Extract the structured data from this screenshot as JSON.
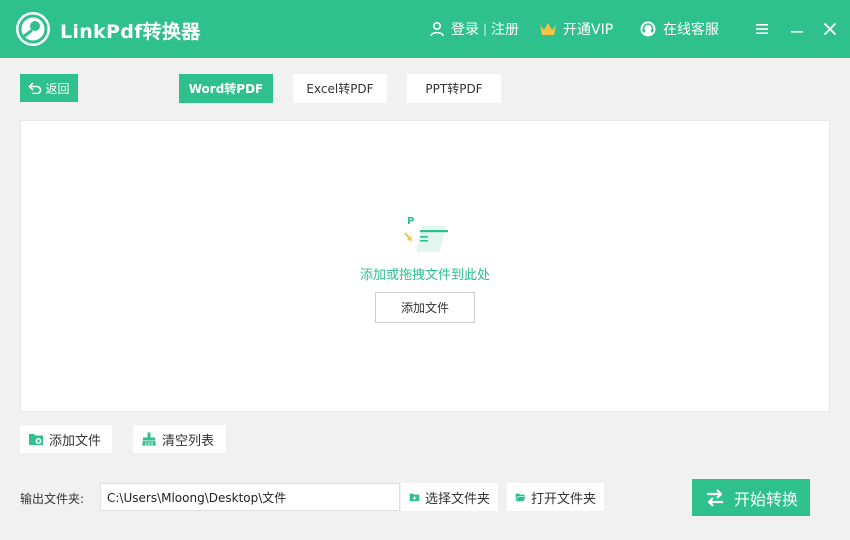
{
  "window": {
    "title": "LinkPdf转换器",
    "login_label": "登录",
    "separator": "|",
    "register_label": "注册",
    "vip_label": "开通VIP",
    "service_label": "在线客服"
  },
  "toolbar": {
    "back_label": "返回",
    "tabs": [
      {
        "label": "Word转PDF",
        "active": true
      },
      {
        "label": "Excel转PDF",
        "active": false
      },
      {
        "label": "PPT转PDF",
        "active": false
      }
    ]
  },
  "dropzone": {
    "hint": "添加或拖拽文件到此处",
    "add_button": "添加文件"
  },
  "actions": {
    "add_files": "添加文件",
    "clear_list": "清空列表"
  },
  "output": {
    "label": "输出文件夹:",
    "path": "C:\\Users\\Mloong\\Desktop\\文件",
    "choose_folder": "选择文件夹",
    "open_folder": "打开文件夹"
  },
  "start_label": "开始转换",
  "colors": {
    "accent": "#2ec08d",
    "background": "#f1f1f1",
    "vip_crown": "#f6c342"
  },
  "icons": [
    "app-logo-icon",
    "user-icon",
    "crown-icon",
    "headset-icon",
    "menu-icon",
    "minimize-icon",
    "close-icon",
    "back-arrow-icon",
    "file-drop-icon",
    "folder-add-icon",
    "broom-icon",
    "folder-open-icon",
    "convert-icon"
  ]
}
